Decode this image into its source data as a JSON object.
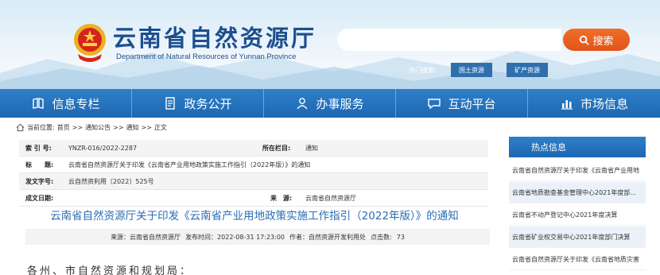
{
  "header": {
    "title": "云南省自然资源厅",
    "subtitle": "Department of Natural Resources of Yunnan Province"
  },
  "search": {
    "placeholder": "",
    "button_label": "搜索",
    "hot_label": "热门搜索:",
    "hot_tags": [
      "国土资源",
      "矿产资源"
    ]
  },
  "nav": {
    "items": [
      {
        "label": "信息专栏",
        "icon": "book-icon"
      },
      {
        "label": "政务公开",
        "icon": "document-icon"
      },
      {
        "label": "办事服务",
        "icon": "person-icon"
      },
      {
        "label": "互动平台",
        "icon": "chat-icon"
      },
      {
        "label": "市场信息",
        "icon": "bar-chart-icon"
      }
    ]
  },
  "breadcrumb": {
    "prefix": "当前位置:",
    "items": [
      "首页",
      ">>",
      "通知公告",
      ">>",
      "通知",
      ">>",
      "正文"
    ]
  },
  "meta": {
    "index_label": "索 引 号:",
    "index_value": "YNZR-016/2022-2287",
    "column_label": "所在栏目:",
    "column_value": "通知",
    "subject_label": "标　　题:",
    "subject_value": "云南省自然资源厅关于印发《云南省产业用地政策实施工作指引（2022年版）》的通知",
    "docno_label": "发文字号:",
    "docno_value": "云自然资利用〔2022〕525号",
    "date_label": "成文日期:",
    "date_value": "",
    "source_label": "来　源:",
    "source_value": "云南省自然资源厅"
  },
  "article": {
    "title": "云南省自然资源厅关于印发《云南省产业用地政策实施工作指引（2022年版）》的通知",
    "info": {
      "source": "来源：云南省自然资源厅",
      "time": "发布时间：2022-08-31 17:23:00",
      "author": "作者：自然资源开发利用处",
      "clicks_label": "点击数:",
      "clicks": "73"
    },
    "salutation": "各州、市自然资源和规划局："
  },
  "sidebar": {
    "heading": "热点信息",
    "items": [
      "云南省自然资源厅关于印发《云南省产业用地",
      "云南省地质勘查基金管理中心2021年度部...",
      "云南省不动产登记中心2021年度决算",
      "云南省矿业权交易中心2021年度部门决算",
      "云南省自然资源厅关于印发《云南省地质灾害"
    ]
  },
  "colors": {
    "nav_blue": "#1d67b3",
    "title_blue": "#2a6db5",
    "search_orange": "#e25418"
  }
}
